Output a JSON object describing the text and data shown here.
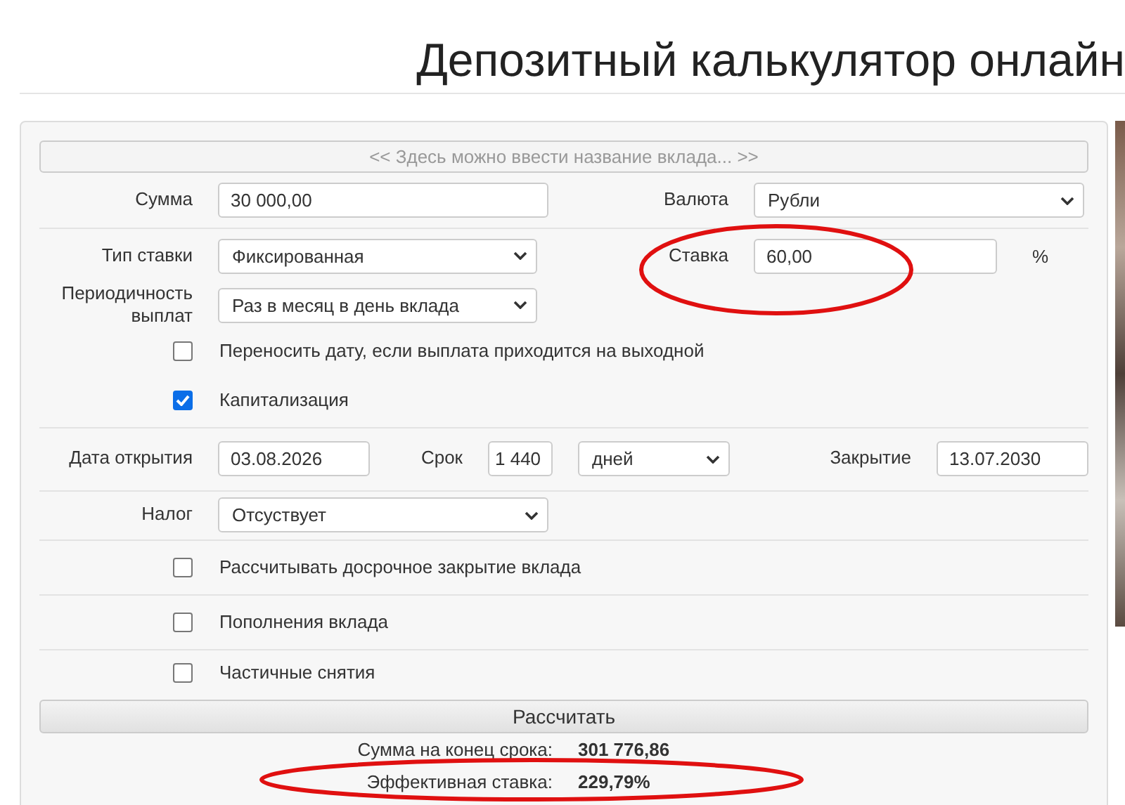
{
  "title": "Депозитный калькулятор онлайн",
  "deposit_name": {
    "placeholder": "<< Здесь можно ввести название вклада... >>"
  },
  "amount": {
    "label": "Сумма",
    "value": "30 000,00"
  },
  "currency": {
    "label": "Валюта",
    "value": "Рубли"
  },
  "rate_type": {
    "label": "Тип ставки",
    "value": "Фиксированная"
  },
  "rate": {
    "label": "Ставка",
    "value": "60,00",
    "unit": "%"
  },
  "payout_frequency": {
    "label": "Периодичность выплат",
    "value": "Раз в месяц в день вклада"
  },
  "options": [
    {
      "label": "Переносить дату, если выплата приходится на выходной",
      "checked": false
    },
    {
      "label": "Капитализация",
      "checked": true
    }
  ],
  "open_date": {
    "label": "Дата открытия",
    "value": "03.08.2026"
  },
  "term": {
    "label": "Срок",
    "value": "1 440",
    "unit": "дней"
  },
  "close_date": {
    "label": "Закрытие",
    "value": "13.07.2030"
  },
  "tax": {
    "label": "Налог",
    "value": "Отсуствует"
  },
  "extra_options": [
    {
      "label": "Рассчитывать досрочное закрытие вклада",
      "checked": false
    },
    {
      "label": "Пополнения вклада",
      "checked": false
    },
    {
      "label": "Частичные снятия",
      "checked": false
    }
  ],
  "calculate_button": "Рассчитать",
  "results": [
    {
      "label": "Сумма на конец срока:",
      "value": "301 776,86"
    },
    {
      "label": "Эффективная ставка:",
      "value": "229,79%"
    }
  ]
}
